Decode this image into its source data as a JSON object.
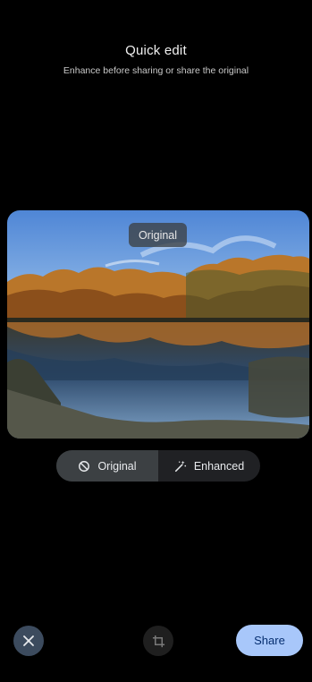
{
  "header": {
    "title": "Quick edit",
    "subtitle": "Enhance before sharing or share the original"
  },
  "photo": {
    "badge": "Original",
    "icon": "landscape-lake-autumn-photo"
  },
  "toggle": {
    "original_label": "Original",
    "original_icon": "block-icon",
    "enhanced_label": "Enhanced",
    "enhanced_icon": "magic-wand-icon",
    "selected": "original"
  },
  "actions": {
    "close_icon": "close-icon",
    "crop_icon": "crop-icon",
    "share_label": "Share"
  },
  "colors": {
    "background": "#000000",
    "share_button": "#a8c7fa",
    "toggle_selected": "#3c4043",
    "close_button": "#3c4b5e"
  }
}
